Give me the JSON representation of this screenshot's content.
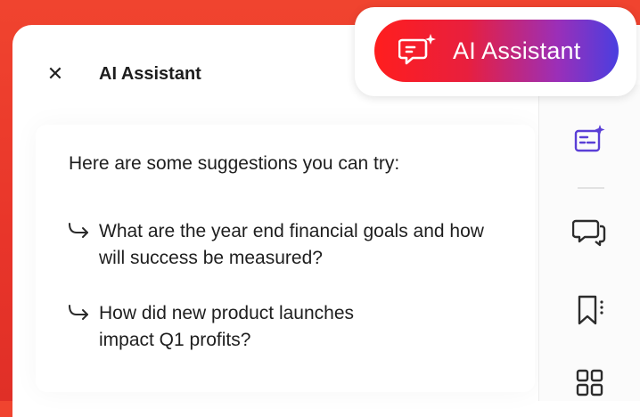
{
  "header": {
    "close_icon": "close-icon",
    "title": "AI Assistant"
  },
  "content": {
    "intro": "Here are some suggestions you can try:",
    "suggestions": [
      {
        "line1": "What are the year end financial goals and how",
        "line2": "will success be measured?"
      },
      {
        "line1": "How did new product launches",
        "line2": "impact Q1 profits?"
      }
    ]
  },
  "assistant_chip": {
    "label": "AI Assistant",
    "icon": "ai-chat-sparkle-icon"
  },
  "rail": {
    "icons": [
      "ai-assistant-icon",
      "comment-icon",
      "bookmark-icon",
      "thumbnails-icon"
    ]
  },
  "colors": {
    "background": "#e8352a",
    "accent": "#5a3fd6",
    "chip_start": "#ff1e1e",
    "chip_end": "#4a3ee0"
  }
}
